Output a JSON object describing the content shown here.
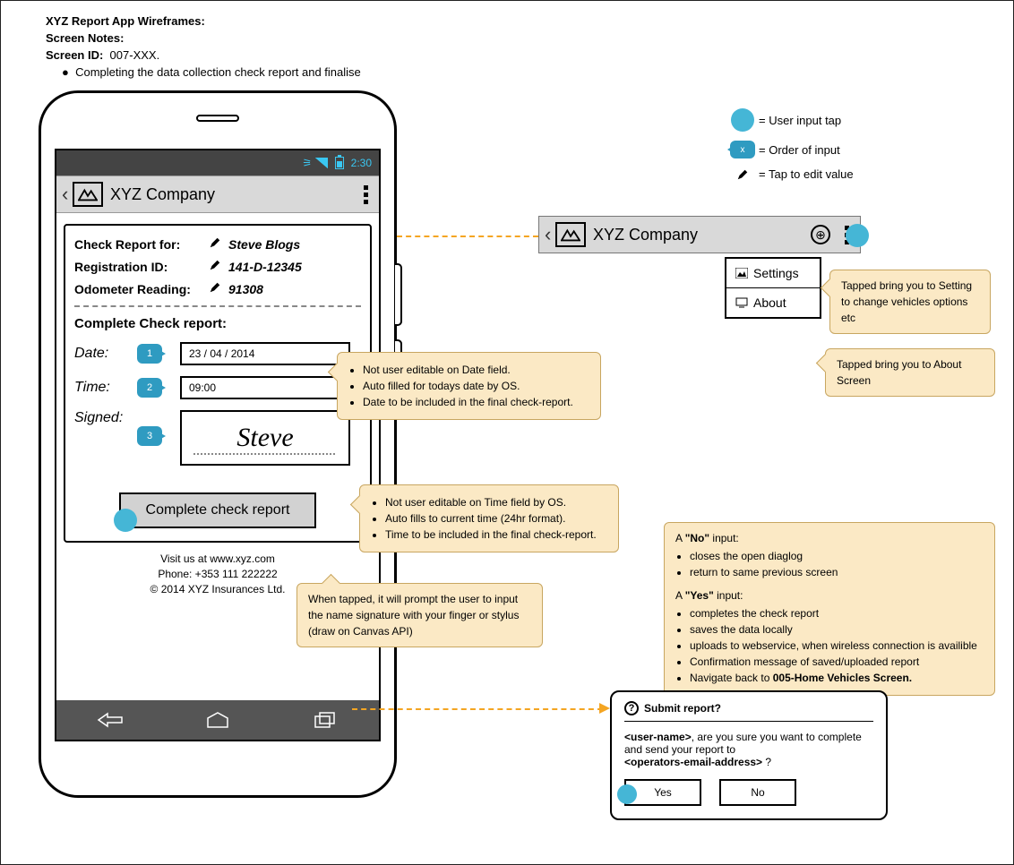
{
  "header": {
    "line1": "XYZ Report App Wireframes:",
    "line2": "Screen Notes:",
    "line3_label": "Screen ID:",
    "line3_value": "007-XXX.",
    "bullet": "Completing the data collection check report and finalise"
  },
  "status": {
    "time": "2:30"
  },
  "appbar": {
    "title": "XYZ Company"
  },
  "report": {
    "heading_for": "Check Report for:",
    "name": "Steve Blogs",
    "reg_label": "Registration ID:",
    "reg_value": "141-D-12345",
    "odo_label": "Odometer Reading:",
    "odo_value": "91308",
    "subtitle": "Complete Check report:",
    "date_label": "Date:",
    "date_value": "23 / 04 / 2014",
    "time_label": "Time:",
    "time_value": "09:00",
    "signed_label": "Signed:",
    "signature": "Steve",
    "button": "Complete check report"
  },
  "order": {
    "date": "1",
    "time": "2",
    "signed": "3"
  },
  "footer": {
    "visit": "Visit us at www.xyz.com",
    "phone": "Phone: +353 111 222222",
    "copyright": "© 2014 XYZ Insurances Ltd."
  },
  "legend": {
    "tap": "= User input tap",
    "order": "= Order of input",
    "order_sym": "x",
    "edit": "= Tap to edit value"
  },
  "callouts": {
    "date": {
      "b1": "Not user editable on Date field.",
      "b2": "Auto filled for todays date by OS.",
      "b3": "Date to be included in the final check-report."
    },
    "time": {
      "b1": "Not user editable on Time field by OS.",
      "b2": "Auto fills to current time (24hr format).",
      "b3": "Time to be included in the final check-report."
    },
    "sig": "When tapped, it will prompt the user to input the name signature with your finger or stylus (draw on Canvas API)",
    "settings": "Tapped bring you to Setting to change vehicles options etc",
    "about": "Tapped bring you to About Screen",
    "yesno": {
      "no_lead": "A \"No\" input:",
      "no_b1": "closes the open diaglog",
      "no_b2": "return to same previous screen",
      "yes_lead": "A \"Yes\" input:",
      "yes_b1": "completes the check report",
      "yes_b2": "saves the data locally",
      "yes_b3": "uploads to webservice, when wireless connection is availible",
      "yes_b4": "Confirmation message of saved/uploaded report",
      "yes_b5_prefix": "Navigate back to ",
      "yes_b5_bold": "005-Home Vehicles Screen."
    }
  },
  "menu": {
    "settings": "Settings",
    "about": "About"
  },
  "dialog": {
    "title": "Submit report?",
    "body_user": "<user-name>",
    "body_mid": ", are you sure you want to complete and send your report to",
    "body_email": "<operators-email-address>",
    "body_q": " ?",
    "yes": "Yes",
    "no": "No"
  }
}
